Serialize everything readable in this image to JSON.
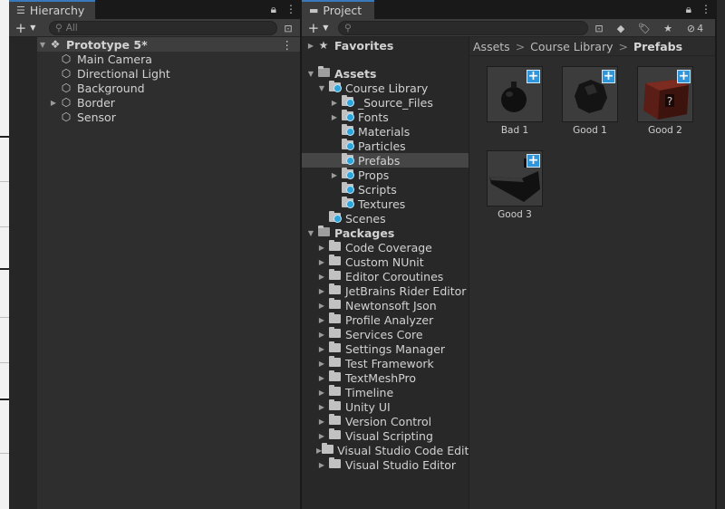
{
  "hierarchy": {
    "tab_label": "Hierarchy",
    "search_placeholder": "All",
    "scene_name": "Prototype 5*",
    "objects": [
      "Main Camera",
      "Directional Light",
      "Background",
      "Border",
      "Sensor"
    ]
  },
  "project": {
    "tab_label": "Project",
    "hidden_count": "4",
    "favorites_label": "Favorites",
    "assets_label": "Assets",
    "course_library_label": "Course Library",
    "course_library_children": [
      "_Source_Files",
      "Fonts",
      "Materials",
      "Particles",
      "Prefabs",
      "Props",
      "Scripts",
      "Textures"
    ],
    "scenes_label": "Scenes",
    "packages_label": "Packages",
    "packages": [
      "Code Coverage",
      "Custom NUnit",
      "Editor Coroutines",
      "JetBrains Rider Editor",
      "Newtonsoft Json",
      "Profile Analyzer",
      "Services Core",
      "Settings Manager",
      "Test Framework",
      "TextMeshPro",
      "Timeline",
      "Unity UI",
      "Version Control",
      "Visual Scripting",
      "Visual Studio Code Editor",
      "Visual Studio Editor"
    ],
    "breadcrumb": [
      "Assets",
      "Course Library",
      "Prefabs"
    ],
    "prefabs": [
      "Bad 1",
      "Good 1",
      "Good 2",
      "Good 3"
    ]
  },
  "colors": {
    "accent_blue": "#3095d9",
    "selection": "#464646",
    "panel": "#282828"
  }
}
